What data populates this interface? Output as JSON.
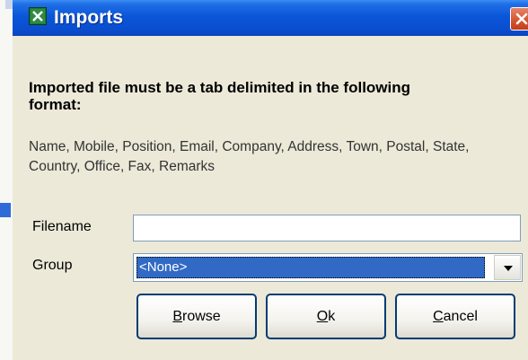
{
  "window": {
    "title": "Imports",
    "icon": "spreadsheet-icon",
    "close_icon": "close-icon"
  },
  "instructions": {
    "heading": "Imported file must be a tab delimited in the following format:",
    "fields": "Name, Mobile, Position, Email, Company, Address, Town, Postal, State, Country, Office, Fax, Remarks"
  },
  "form": {
    "filename_label": "Filename",
    "filename_value": "",
    "group_label": "Group",
    "group_value": "<None>"
  },
  "buttons": {
    "browse_mnemonic": "B",
    "browse_rest": "rowse",
    "ok_mnemonic": "O",
    "ok_rest": "k",
    "cancel_mnemonic": "C",
    "cancel_rest": "ancel"
  },
  "colors": {
    "titlebar": "#0a4ed0",
    "selection": "#316ac5",
    "dialog_bg": "#ece9d8"
  }
}
